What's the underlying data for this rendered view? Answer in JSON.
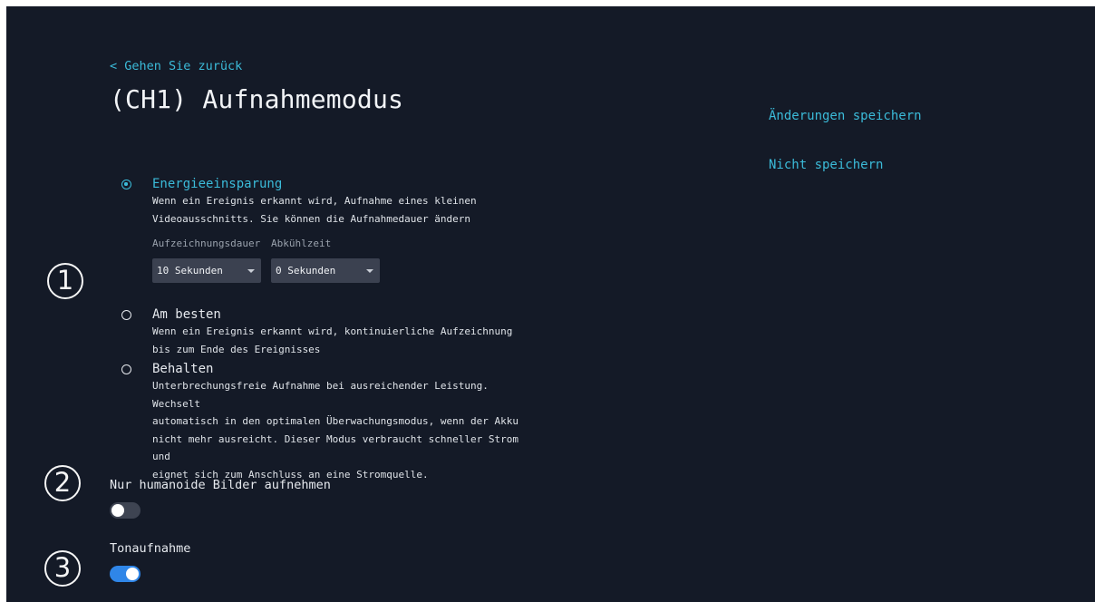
{
  "header": {
    "back_label": "< Gehen Sie zurück",
    "title": "(CH1) Aufnahmemodus"
  },
  "actions": {
    "save_label": "Änderungen speichern",
    "discard_label": "Nicht speichern"
  },
  "recording_modes": [
    {
      "title": "Energieeinsparung",
      "selected": true,
      "description_lines": [
        "Wenn ein Ereignis erkannt wird, Aufnahme eines kleinen",
        "Videoausschnitts. Sie können die Aufnahmedauer ändern"
      ]
    },
    {
      "title": "Am besten",
      "selected": false,
      "description_lines": [
        "Wenn ein Ereignis erkannt wird, kontinuierliche Aufzeichnung",
        "bis zum Ende des Ereignisses"
      ]
    },
    {
      "title": "Behalten",
      "selected": false,
      "description_lines": [
        "Unterbrechungsfreie Aufnahme bei ausreichender Leistung. Wechselt",
        "automatisch in den optimalen Überwachungsmodus, wenn der Akku",
        "nicht mehr ausreicht. Dieser Modus verbraucht schneller Strom und",
        "eignet sich zum Anschluss an eine Stromquelle."
      ]
    }
  ],
  "duration_fields": {
    "recording_duration": {
      "label": "Aufzeichnungsdauer",
      "value": "10 Sekunden"
    },
    "cooldown": {
      "label": "Abkühlzeit",
      "value": "0 Sekunden"
    }
  },
  "toggles": {
    "humanoid_only": {
      "label": "Nur humanoide Bilder aufnehmen",
      "on": false
    },
    "audio_recording": {
      "label": "Tonaufnahme",
      "on": true
    }
  },
  "markers": [
    "1",
    "2",
    "3"
  ],
  "colors": {
    "background": "#141a27",
    "accent": "#3bbbd9",
    "toggle_on": "#2f86e8",
    "toggle_off": "#3e4452",
    "select_bg": "#3b4150"
  }
}
